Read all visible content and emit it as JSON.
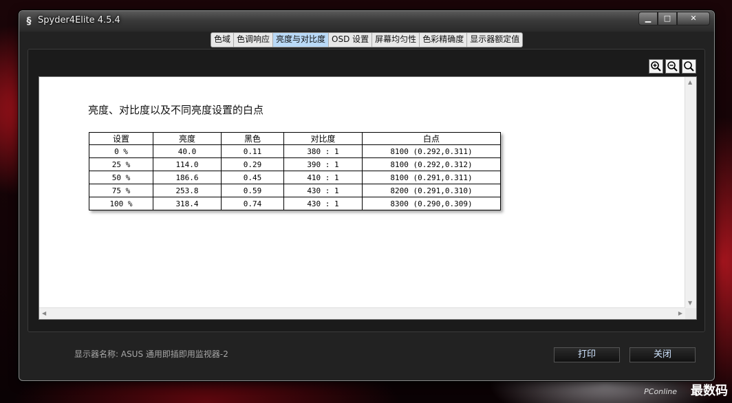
{
  "window": {
    "title": "Spyder4Elite 4.5.4"
  },
  "tabs": [
    "色域",
    "色调响应",
    "亮度与对比度",
    "OSD 设置",
    "屏幕均匀性",
    "色彩精确度",
    "显示器额定值"
  ],
  "active_tab": "亮度与对比度",
  "report": {
    "title": "亮度、对比度以及不同亮度设置的白点",
    "columns": [
      "设置",
      "亮度",
      "黑色",
      "对比度",
      "白点"
    ],
    "rows": [
      [
        "0 %",
        "40.0",
        "0.11",
        "380 : 1",
        "8100 (0.292,0.311)"
      ],
      [
        "25 %",
        "114.0",
        "0.29",
        "390 : 1",
        "8100 (0.292,0.312)"
      ],
      [
        "50 %",
        "186.6",
        "0.45",
        "410 : 1",
        "8100 (0.291,0.311)"
      ],
      [
        "75 %",
        "253.8",
        "0.59",
        "430 : 1",
        "8200 (0.291,0.310)"
      ],
      [
        "100 %",
        "318.4",
        "0.74",
        "430 : 1",
        "8300 (0.290,0.309)"
      ]
    ]
  },
  "footer": {
    "display_label": "显示器名称: ASUS 通用即插即用监视器-2",
    "print_button": "打印",
    "close_button": "关闭"
  },
  "watermark": {
    "brand": "PConline",
    "text": "最数码"
  },
  "colors": {
    "active_tab": "#b9d9f7",
    "window_bg": "#222222"
  }
}
